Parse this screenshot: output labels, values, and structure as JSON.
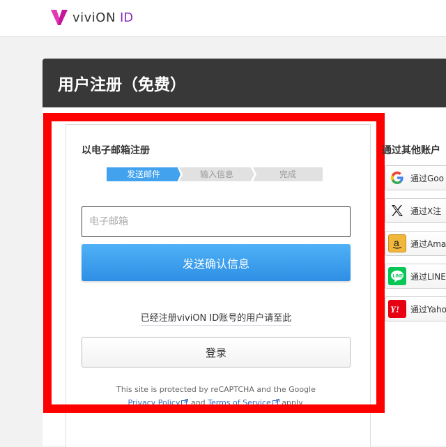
{
  "header": {
    "logo_text": "viviON",
    "logo_id": "ID"
  },
  "page": {
    "title": "用户注册（免费）"
  },
  "register": {
    "heading": "以电子邮箱注册",
    "steps": [
      "发送邮件",
      "输入信息",
      "完成"
    ],
    "email_placeholder": "电子邮箱",
    "send_button": "发送确认信息",
    "existing_account_text": "已经注册viviON ID账号的用户请至此",
    "login_button": "登录",
    "recaptcha": {
      "line1": "This site is protected by reCAPTCHA and the Google",
      "privacy_link": "Privacy Policy",
      "and": "and",
      "terms_link": "Terms of Service",
      "apply": "apply."
    }
  },
  "social": {
    "heading": "通过其他账户",
    "buttons": [
      {
        "label": "通过Goo",
        "icon": "google-icon"
      },
      {
        "label": "通过X注",
        "icon": "x-icon"
      },
      {
        "label": "通过Ama",
        "icon": "amazon-icon"
      },
      {
        "label": "通过LINE",
        "icon": "line-icon"
      },
      {
        "label": "通过Yaho",
        "icon": "yahoo-icon"
      }
    ]
  },
  "colors": {
    "primary_blue": "#42a2ee",
    "title_bar": "#383838",
    "highlight": "#ff0000",
    "brand_purple": "#8a2bbf"
  }
}
